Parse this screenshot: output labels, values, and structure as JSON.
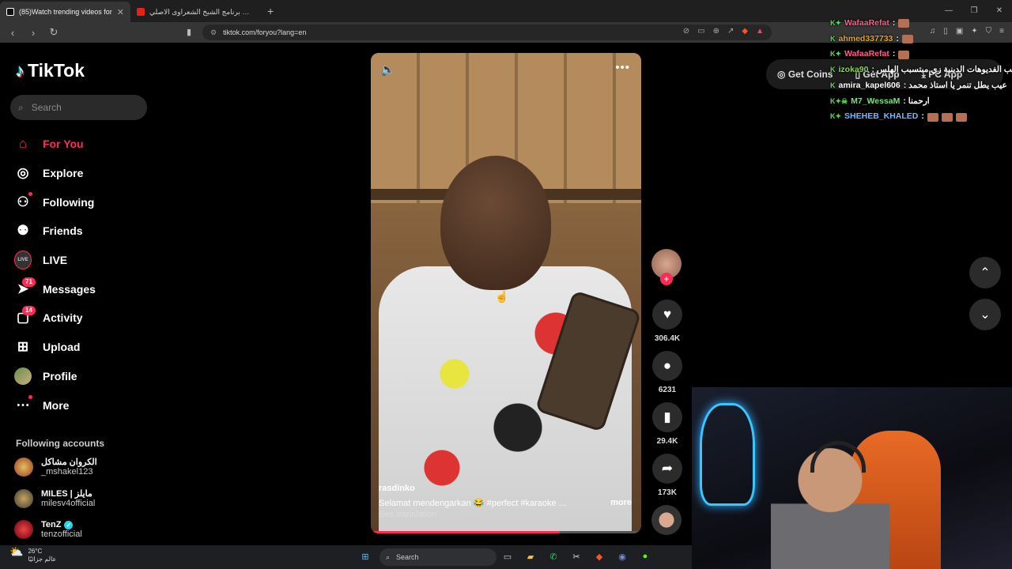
{
  "browser": {
    "tabs": [
      {
        "title": "(85)Watch trending videos for",
        "active": true,
        "icon_color": "#222222"
      },
      {
        "title": "موسيقى برنامج الشيخ الشعراوى الاصلي",
        "active": false,
        "icon_color": "#e62117"
      }
    ],
    "url": "tiktok.com/foryou?lang=en"
  },
  "sidebar": {
    "logo": "TikTok",
    "search_placeholder": "Search",
    "nav": [
      {
        "label": "For You",
        "icon": "home-icon",
        "active": true
      },
      {
        "label": "Explore",
        "icon": "compass-icon"
      },
      {
        "label": "Following",
        "icon": "following-icon"
      },
      {
        "label": "Friends",
        "icon": "friends-icon"
      },
      {
        "label": "LIVE",
        "icon": "live-icon"
      },
      {
        "label": "Messages",
        "icon": "messages-icon",
        "badge": "71"
      },
      {
        "label": "Activity",
        "icon": "activity-icon",
        "badge": "14"
      },
      {
        "label": "Upload",
        "icon": "upload-icon"
      },
      {
        "label": "Profile",
        "icon": "profile-avatar"
      },
      {
        "label": "More",
        "icon": "more-icon"
      }
    ],
    "following_header": "Following accounts",
    "accounts": [
      {
        "name": "الكروان مشاكل",
        "handle": "_mshakel123",
        "verified": false
      },
      {
        "name": "MILES | مايلز",
        "handle": "milesv4official",
        "verified": false
      },
      {
        "name": "TenZ",
        "handle": "tenzofficial",
        "verified": true
      }
    ]
  },
  "video": {
    "username": "rasdinko",
    "caption": "Selamat mendengarkan 😂 #perfect #karaoke ...",
    "more_label": "more",
    "translation_label": "See translation",
    "progress": 0.7
  },
  "actions": {
    "likes": "306.4K",
    "comments": "6231",
    "saves": "29.4K",
    "shares": "173K"
  },
  "top_right": {
    "get_coins": "Get Coins",
    "get_app": "Get App",
    "pc_app": "PC App"
  },
  "chat": [
    {
      "user": "WafaaRefat",
      "user_color": "#ff5c8a",
      "text": ":"
    },
    {
      "user": "ahmed337733",
      "user_color": "#e0a52b",
      "text": ":"
    },
    {
      "user": "WafaaRefat",
      "user_color": "#ff5c8a",
      "text": ":"
    },
    {
      "user": "izoka90",
      "user_color": "#8fd05a",
      "text": ": مع سبب الفديوهات الدينية زي مبتسبب الهلس"
    },
    {
      "user": "amira_kapel606",
      "user_color": "#ffffff",
      "text": ": عيب يطل تنمر يا استاذ محمد"
    },
    {
      "user": "M7_WessaM",
      "user_color": "#7be07b",
      "text": ": ارحمنا"
    },
    {
      "user": "SHEHEB_KHALED",
      "user_color": "#7ab6ff",
      "text": ":"
    }
  ],
  "taskbar": {
    "temp": "26°C",
    "weather_text": "عالم جزائيًا",
    "search": "Search"
  }
}
